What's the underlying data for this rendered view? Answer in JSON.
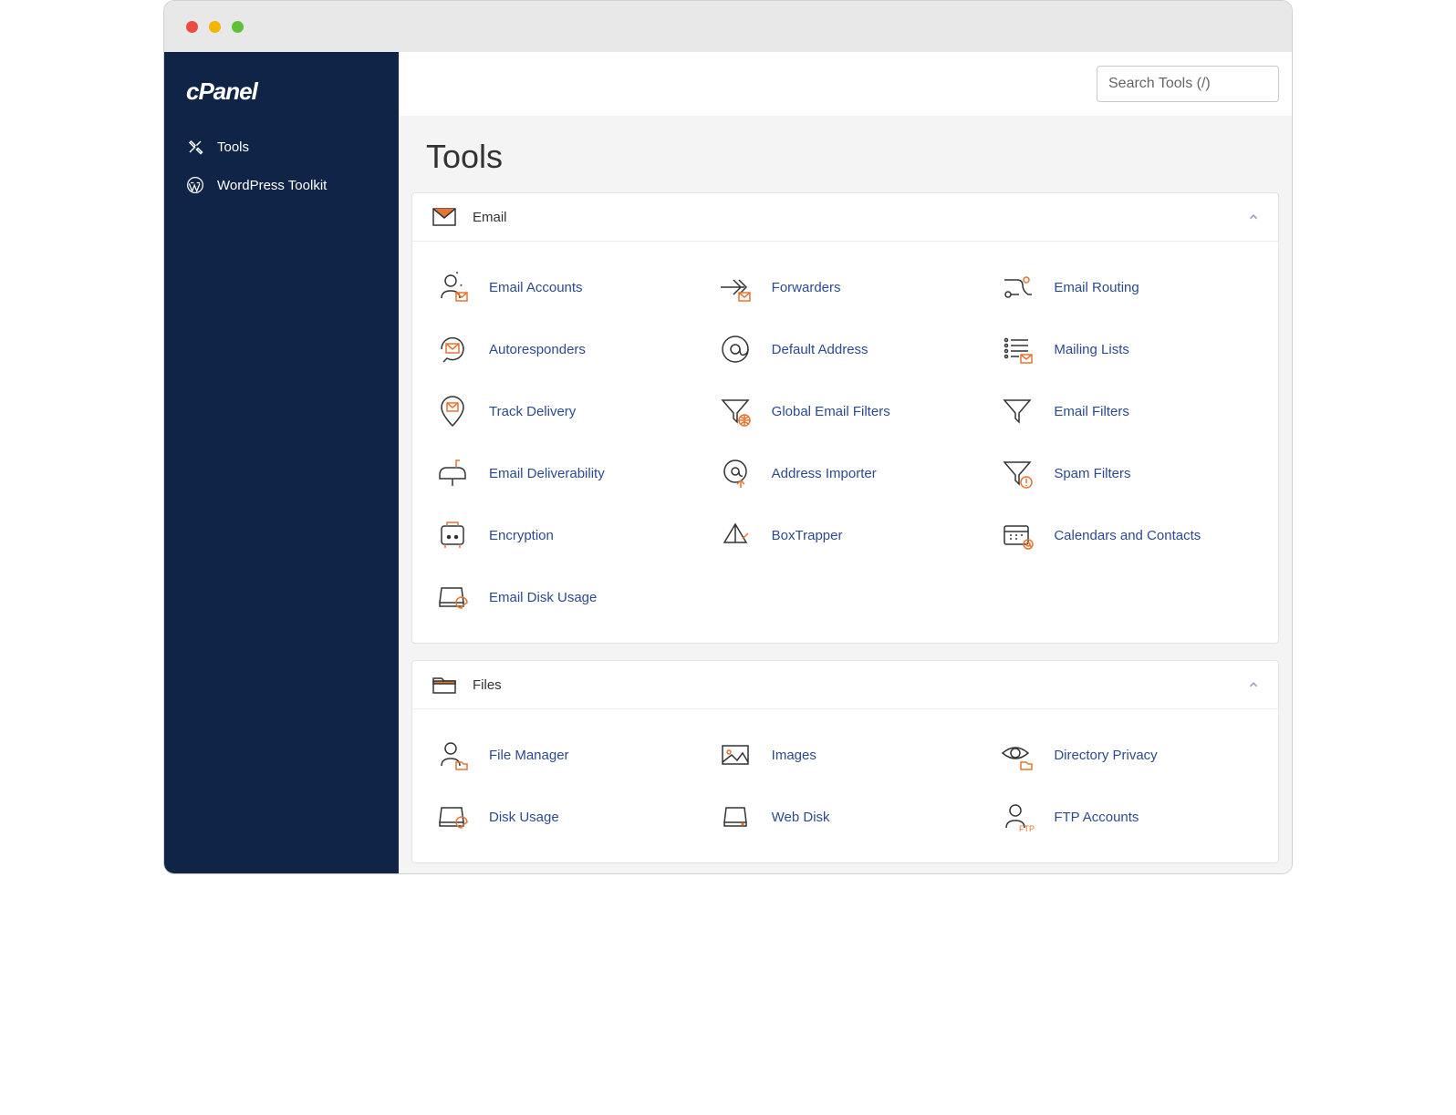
{
  "brand": "cPanel",
  "sidebar": {
    "items": [
      {
        "label": "Tools"
      },
      {
        "label": "WordPress Toolkit"
      }
    ]
  },
  "search": {
    "placeholder": "Search Tools (/)"
  },
  "page_title": "Tools",
  "sections": [
    {
      "title": "Email",
      "tools": [
        {
          "label": "Email Accounts"
        },
        {
          "label": "Forwarders"
        },
        {
          "label": "Email Routing"
        },
        {
          "label": "Autoresponders"
        },
        {
          "label": "Default Address"
        },
        {
          "label": "Mailing Lists"
        },
        {
          "label": "Track Delivery"
        },
        {
          "label": "Global Email Filters"
        },
        {
          "label": "Email Filters"
        },
        {
          "label": "Email Deliverability"
        },
        {
          "label": "Address Importer"
        },
        {
          "label": "Spam Filters"
        },
        {
          "label": "Encryption"
        },
        {
          "label": "BoxTrapper"
        },
        {
          "label": "Calendars and Contacts"
        },
        {
          "label": "Email Disk Usage"
        }
      ]
    },
    {
      "title": "Files",
      "tools": [
        {
          "label": "File Manager"
        },
        {
          "label": "Images"
        },
        {
          "label": "Directory Privacy"
        },
        {
          "label": "Disk Usage"
        },
        {
          "label": "Web Disk"
        },
        {
          "label": "FTP Accounts"
        }
      ]
    }
  ]
}
